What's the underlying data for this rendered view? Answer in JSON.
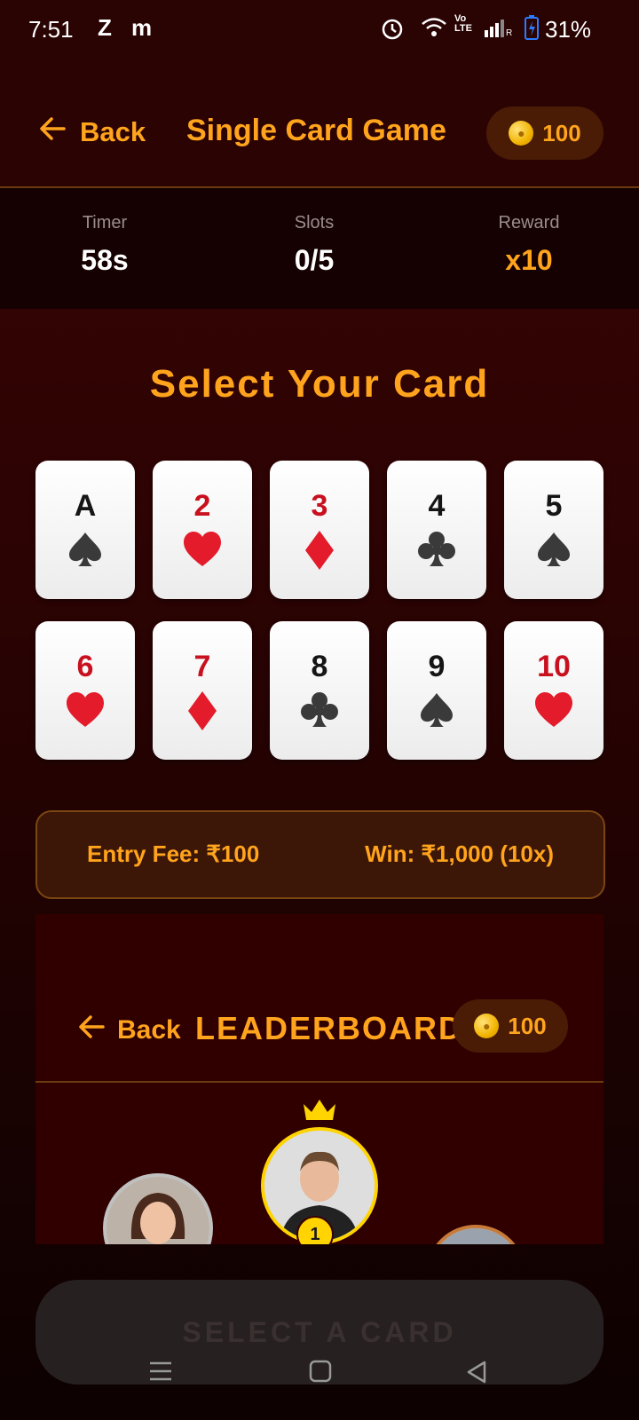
{
  "status_bar": {
    "time": "7:51",
    "app1": "Z",
    "app2": "m",
    "battery": "31%"
  },
  "header": {
    "back_label": "Back",
    "title": "Single Card Game",
    "coins": "100"
  },
  "stats": [
    {
      "label": "Timer",
      "value": "58s"
    },
    {
      "label": "Slots",
      "value": "0/5"
    },
    {
      "label": "Reward",
      "value": "x10"
    }
  ],
  "select_title": "Select Your Card",
  "cards": [
    {
      "rank": "A",
      "suit": "spade",
      "color": "#151515"
    },
    {
      "rank": "2",
      "suit": "heart",
      "color": "#c8101e"
    },
    {
      "rank": "3",
      "suit": "diamond",
      "color": "#c8101e"
    },
    {
      "rank": "4",
      "suit": "club",
      "color": "#151515"
    },
    {
      "rank": "5",
      "suit": "spade",
      "color": "#151515"
    },
    {
      "rank": "6",
      "suit": "heart",
      "color": "#c8101e"
    },
    {
      "rank": "7",
      "suit": "diamond",
      "color": "#c8101e"
    },
    {
      "rank": "8",
      "suit": "club",
      "color": "#151515"
    },
    {
      "rank": "9",
      "suit": "spade",
      "color": "#151515"
    },
    {
      "rank": "10",
      "suit": "heart",
      "color": "#c8101e"
    }
  ],
  "fee": {
    "entry": "Entry Fee: ₹100",
    "win": "Win: ₹1,000 (10x)"
  },
  "leaderboard": {
    "back_label": "Back",
    "title": "LEADERBOARD",
    "coins": "100",
    "first_rank": "1"
  },
  "cta": {
    "label": "SELECT A CARD"
  },
  "colors": {
    "accent": "#ffa41c",
    "background": "#2c0303"
  }
}
